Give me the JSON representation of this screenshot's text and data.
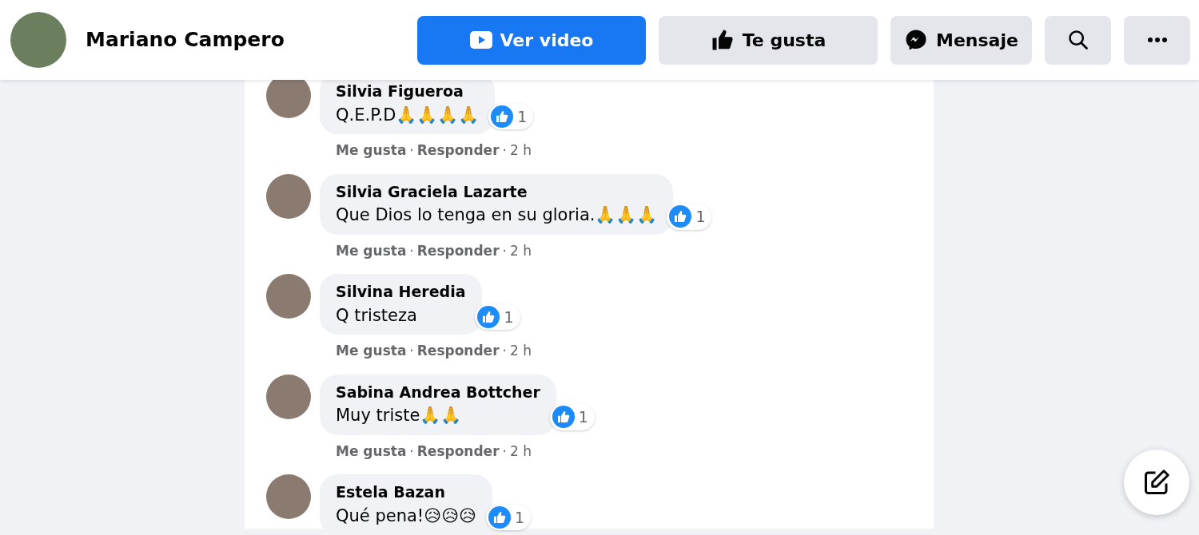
{
  "page_header": {
    "name": "Mariano Campero",
    "buttons": [
      {
        "kind": "primary",
        "label": "Ver video"
      },
      {
        "kind": "secondary",
        "label": "Te gusta"
      },
      {
        "kind": "secondary",
        "label": "Mensaje"
      },
      {
        "kind": "icon"
      },
      {
        "kind": "icon"
      }
    ]
  },
  "comments": [
    {
      "author": "Silvia Figueroa",
      "text": "Q.E.P.D🙏🙏🙏🙏",
      "reactions": "1",
      "actions": [
        {
          "kind": "link",
          "text": "Me gusta"
        },
        {
          "kind": "separator",
          "text": "·"
        },
        {
          "kind": "link",
          "text": "Responder"
        },
        {
          "kind": "separator",
          "text": "·"
        },
        {
          "kind": "time",
          "text": "2 h"
        }
      ]
    },
    {
      "author": "Silvia Graciela Lazarte",
      "text": "Que Dios lo tenga en su gloria.🙏🙏🙏",
      "reactions": "1",
      "actions": [
        {
          "kind": "link",
          "text": "Me gusta"
        },
        {
          "kind": "separator",
          "text": "·"
        },
        {
          "kind": "link",
          "text": "Responder"
        },
        {
          "kind": "separator",
          "text": "·"
        },
        {
          "kind": "time",
          "text": "2 h"
        }
      ]
    },
    {
      "author": "Silvina Heredia",
      "text": "Q tristeza",
      "reactions": "1",
      "actions": [
        {
          "kind": "link",
          "text": "Me gusta"
        },
        {
          "kind": "separator",
          "text": "·"
        },
        {
          "kind": "link",
          "text": "Responder"
        },
        {
          "kind": "separator",
          "text": "·"
        },
        {
          "kind": "time",
          "text": "2 h"
        }
      ]
    },
    {
      "author": "Sabina Andrea Bottcher",
      "text": "Muy triste🙏🙏",
      "reactions": "1",
      "actions": [
        {
          "kind": "link",
          "text": "Me gusta"
        },
        {
          "kind": "separator",
          "text": "·"
        },
        {
          "kind": "link",
          "text": "Responder"
        },
        {
          "kind": "separator",
          "text": "·"
        },
        {
          "kind": "time",
          "text": "2 h"
        }
      ]
    },
    {
      "author": "Estela Bazan",
      "text": "Qué pena!😥😥😥",
      "reactions": "1"
    }
  ]
}
